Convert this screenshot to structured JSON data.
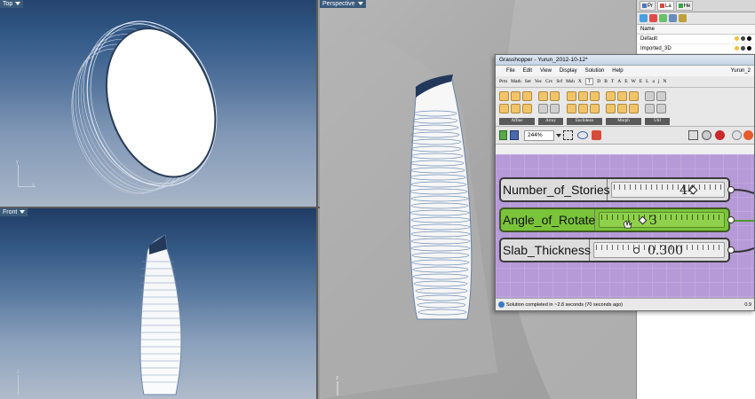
{
  "viewports": {
    "top": {
      "label": "Top",
      "axis_y": "y",
      "axis_x": "x"
    },
    "front": {
      "label": "Front",
      "axis_z": "z"
    },
    "perspective": {
      "label": "Perspective",
      "axis_z": "z"
    }
  },
  "layers_panel": {
    "tabs": [
      "Pr",
      "La",
      "He"
    ],
    "column_name": "Name",
    "rows": [
      {
        "name": "Default"
      },
      {
        "name": "Imported_3D"
      }
    ]
  },
  "grasshopper": {
    "window_title": "Grasshopper - Yurun_2012-10-12*",
    "menu": [
      "File",
      "Edit",
      "View",
      "Display",
      "Solution",
      "Help"
    ],
    "menu_right": "Yurun_2",
    "component_tabs": [
      "Prm",
      "Math",
      "Set",
      "Vec",
      "Crv",
      "Srf",
      "Msh",
      "X",
      "T",
      "D",
      "B",
      "T",
      "A",
      "E",
      "W",
      "E",
      "L",
      "a",
      "j",
      "N"
    ],
    "active_tab_index": 8,
    "ribbon_groups": [
      "Affine",
      "Array",
      "Euclidean",
      "Morph",
      "Util"
    ],
    "zoom": "244%",
    "sliders": [
      {
        "label": "Number_of_Stories",
        "value": "44",
        "fraction": 0.74,
        "active": false
      },
      {
        "label": "Angle_of_Rotate",
        "value": "3",
        "fraction": 0.32,
        "active": true
      },
      {
        "label": "Slab_Thickness",
        "value": "0.300",
        "fraction": 0.3,
        "active": false
      }
    ],
    "status_text": "Solution completed in ~2.8 seconds (70 seconds ago)",
    "status_right": "0.9"
  },
  "colors": {
    "canvas": "#b69ad8",
    "active_slider": "#7ac43a",
    "viewport_sky": "#24446e"
  }
}
